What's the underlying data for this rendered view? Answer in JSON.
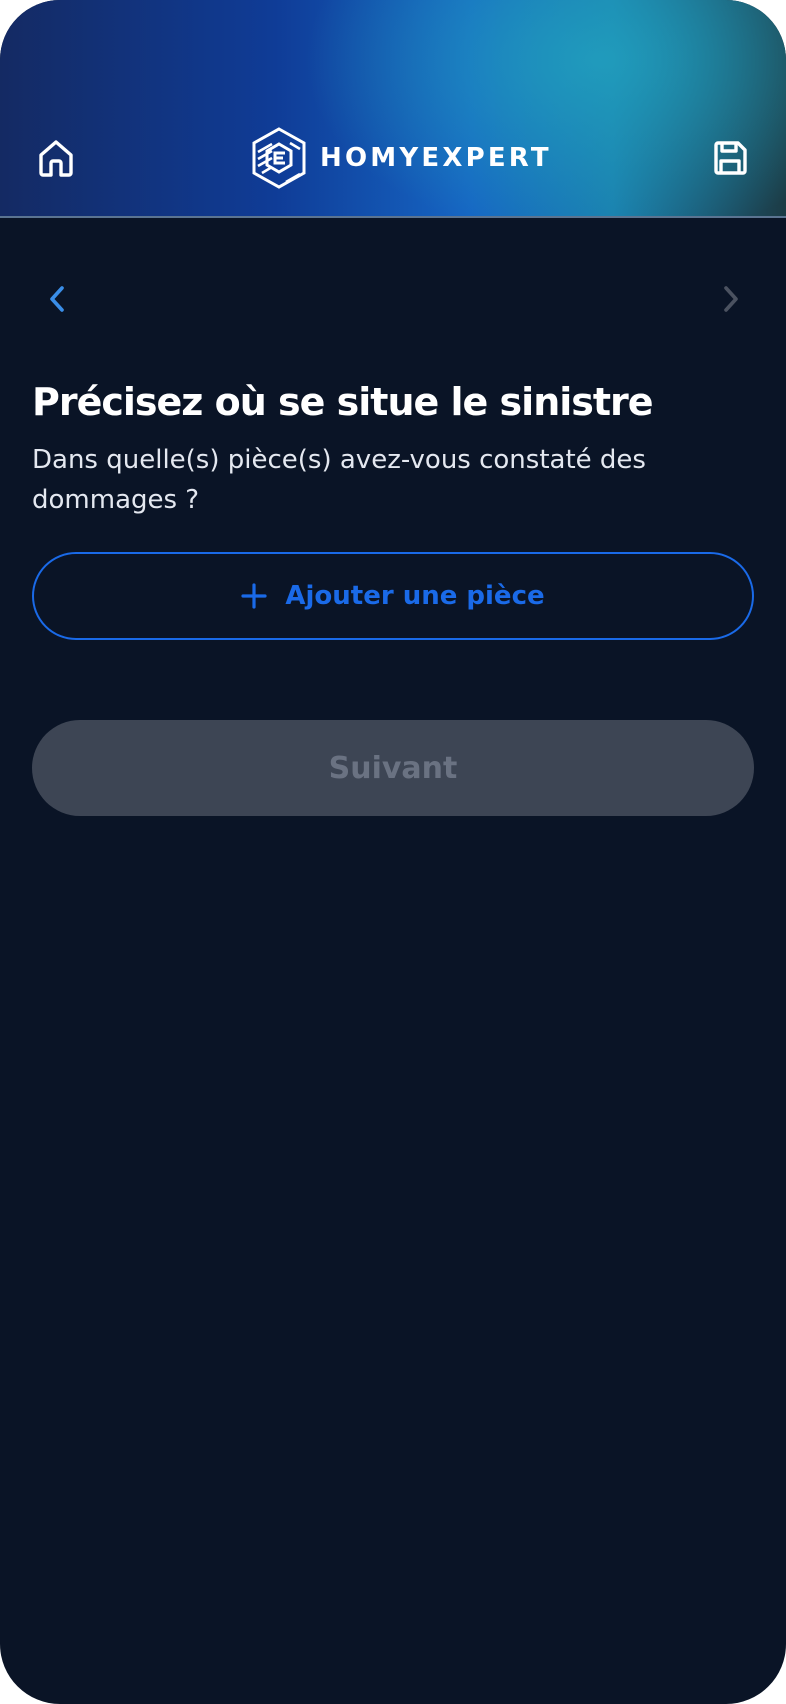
{
  "header": {
    "brand_name": "HOMYEXPERT",
    "home_icon": "home-icon",
    "save_icon": "save-icon",
    "logo_icon": "homyexpert-logo-icon"
  },
  "navigation": {
    "prev_icon": "chevron-left-icon",
    "next_icon": "chevron-right-icon"
  },
  "main": {
    "title": "Précisez où se situe le sinistre",
    "subtitle": "Dans quelle(s) pièce(s) avez-vous constaté des dommages ?",
    "add_room_label": "Ajouter une pièce",
    "add_room_icon": "plus-icon",
    "next_label": "Suivant"
  },
  "colors": {
    "background": "#0a1426",
    "accent": "#1a6ae8",
    "disabled_button": "#3d4554",
    "disabled_text": "#6a7282",
    "prev_arrow": "#3a8ee8",
    "next_arrow_disabled": "#4b5260"
  }
}
